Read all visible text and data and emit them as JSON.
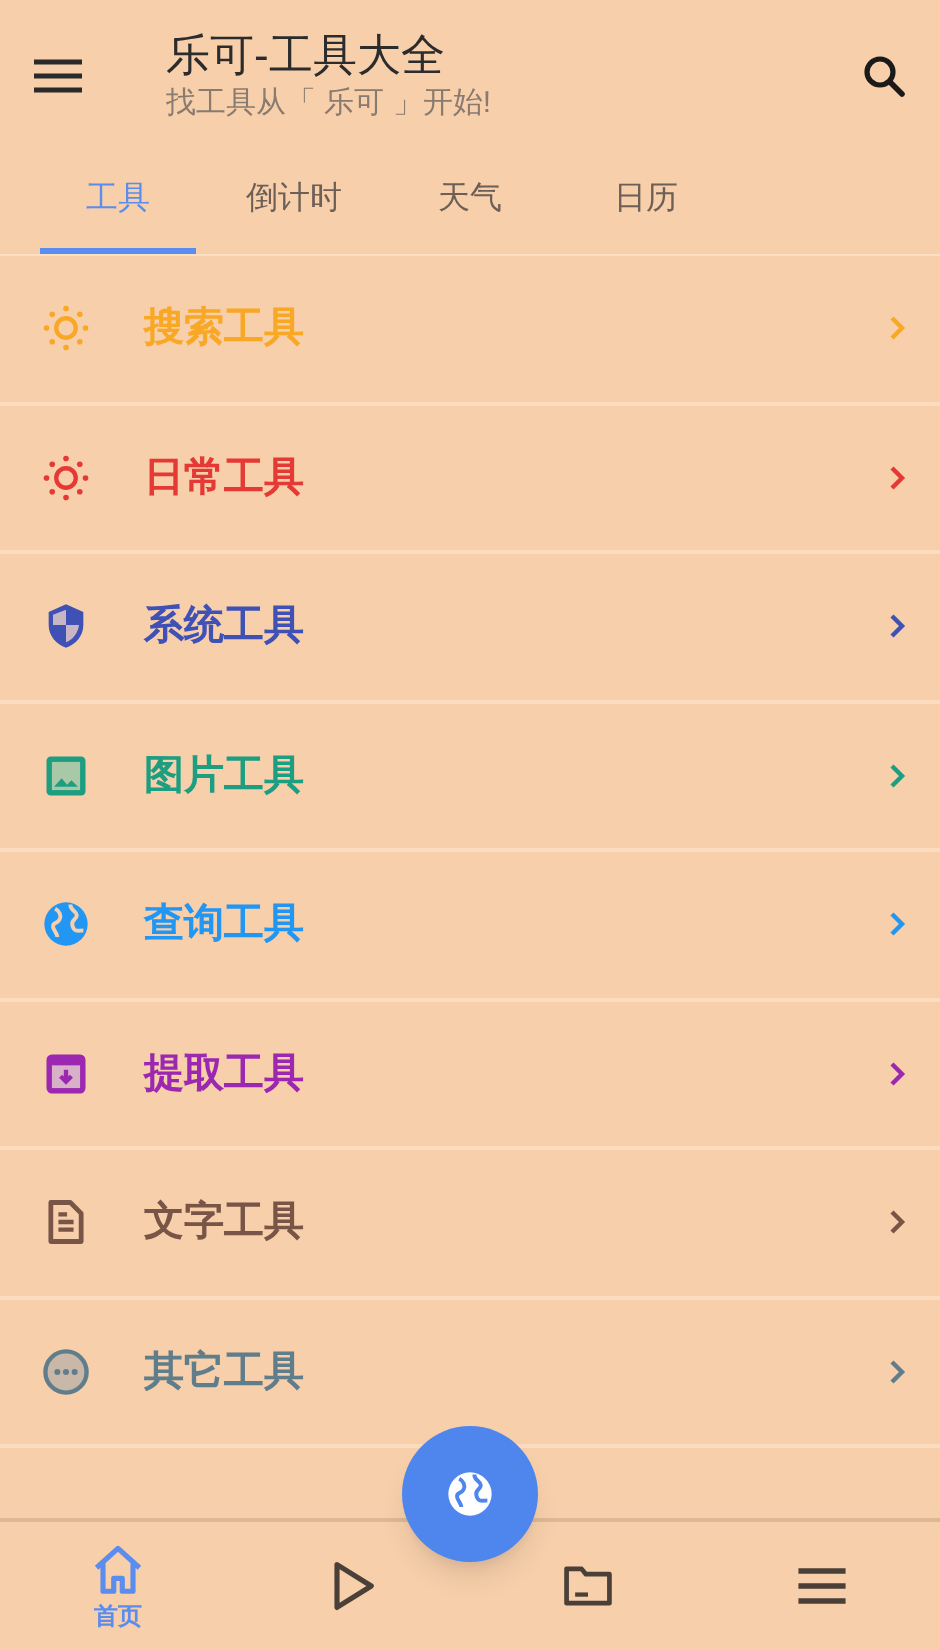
{
  "app_bar": {
    "title": "乐可-工具大全",
    "subtitle": "找工具从「 乐可 」开始!"
  },
  "tabs": [
    {
      "label": "工具",
      "selected": true
    },
    {
      "label": "倒计时",
      "selected": false
    },
    {
      "label": "天气",
      "selected": false
    },
    {
      "label": "日历",
      "selected": false
    }
  ],
  "categories": [
    {
      "kind": "sun",
      "label": "搜索工具",
      "color": "#f9a825"
    },
    {
      "kind": "sun",
      "label": "日常工具",
      "color": "#e53935"
    },
    {
      "kind": "shield",
      "label": "系统工具",
      "color": "#3f51b5"
    },
    {
      "kind": "image",
      "label": "图片工具",
      "color": "#1e9e80"
    },
    {
      "kind": "globe",
      "label": "查询工具",
      "color": "#2196f3"
    },
    {
      "kind": "archive",
      "label": "提取工具",
      "color": "#9c27b0"
    },
    {
      "kind": "document",
      "label": "文字工具",
      "color": "#795548"
    },
    {
      "kind": "more",
      "label": "其它工具",
      "color": "#607d8b"
    }
  ],
  "bottom_nav": [
    {
      "kind": "home",
      "label": "首页",
      "selected": true
    },
    {
      "kind": "play",
      "selected": false
    },
    {
      "kind": "folder",
      "selected": false
    },
    {
      "kind": "menu",
      "selected": false
    }
  ]
}
